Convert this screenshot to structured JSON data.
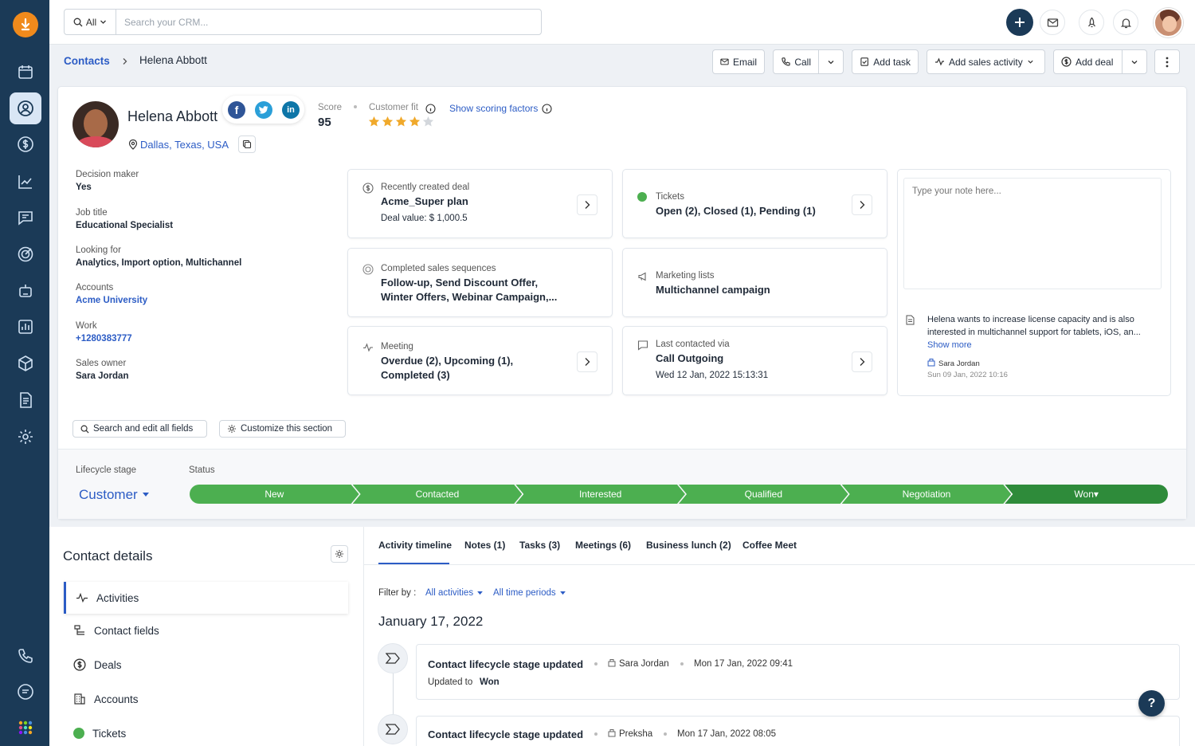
{
  "search": {
    "scope": "All",
    "placeholder": "Search your CRM..."
  },
  "breadcrumb": {
    "parent": "Contacts",
    "current": "Helena Abbott"
  },
  "actions": {
    "email": "Email",
    "call": "Call",
    "add_task": "Add task",
    "add_sales_activity": "Add sales activity",
    "add_deal": "Add deal"
  },
  "contact": {
    "name": "Helena Abbott",
    "location": "Dallas, Texas, USA",
    "score_label": "Score",
    "score": "95",
    "fit_label": "Customer fit",
    "fit_rating": 4,
    "fit_max": 5,
    "show_scoring": "Show scoring factors"
  },
  "fields": [
    {
      "label": "Decision maker",
      "value": "Yes"
    },
    {
      "label": "Job title",
      "value": "Educational Specialist"
    },
    {
      "label": "Looking for",
      "value": "Analytics, Import option, Multichannel"
    },
    {
      "label": "Accounts",
      "value": "Acme University"
    },
    {
      "label": "Work",
      "value": "+1280383777"
    },
    {
      "label": "Sales owner",
      "value": "Sara Jordan"
    }
  ],
  "tiles": {
    "deal": {
      "label": "Recently created deal",
      "main": "Acme_Super plan",
      "sub": "Deal value: $ 1,000.5"
    },
    "tickets": {
      "label": "Tickets",
      "main": "Open (2), Closed (1), Pending (1)"
    },
    "sequences": {
      "label": "Completed sales sequences",
      "main1": "Follow-up, Send Discount Offer,",
      "main2": "Winter Offers, Webinar Campaign,..."
    },
    "marketing": {
      "label": "Marketing lists",
      "main": "Multichannel campaign"
    },
    "meeting": {
      "label": "Meeting",
      "main1": "Overdue (2), Upcoming (1),",
      "main2": "Completed (3)"
    },
    "last_contact": {
      "label": "Last contacted via",
      "main": "Call Outgoing",
      "sub": "Wed 12 Jan, 2022 15:13:31"
    }
  },
  "note": {
    "placeholder": "Type your note here...",
    "text1": "Helena wants to increase license capacity and is also",
    "text2": "interested in multichannel support for tablets, iOS, an...",
    "show_more": "Show more",
    "author": "Sara Jordan",
    "time": "Sun 09 Jan, 2022 10:16"
  },
  "section_buttons": {
    "search_fields": "Search and edit all fields",
    "customize": "Customize this section"
  },
  "lifecycle": {
    "label": "Lifecycle stage",
    "value": "Customer",
    "status_label": "Status",
    "stages": [
      "New",
      "Contacted",
      "Interested",
      "Qualified",
      "Negotiation",
      "Won"
    ],
    "current_stage": "Won"
  },
  "contact_details": {
    "title": "Contact details",
    "items": [
      "Activities",
      "Contact fields",
      "Deals",
      "Accounts",
      "Tickets"
    ]
  },
  "tabs": [
    "Activity timeline",
    "Notes (1)",
    "Tasks (3)",
    "Meetings (6)",
    "Business lunch (2)",
    "Coffee Meet"
  ],
  "filter": {
    "label": "Filter by :",
    "activities": "All activities",
    "periods": "All time periods"
  },
  "timeline": {
    "date": "January 17, 2022",
    "items": [
      {
        "title": "Contact lifecycle stage updated",
        "user": "Sara Jordan",
        "time": "Mon 17 Jan, 2022 09:41",
        "detail_label": "Updated to",
        "detail_value": "Won"
      },
      {
        "title": "Contact lifecycle stage updated",
        "user": "Preksha",
        "time": "Mon 17 Jan, 2022 08:05"
      }
    ]
  },
  "help": "?",
  "colors": {
    "sidebar": "#1b3a57",
    "accent": "#2c5cc5",
    "stage": "#4caf50",
    "stage_current": "#2e8b3a",
    "star": "#f0a92b"
  }
}
